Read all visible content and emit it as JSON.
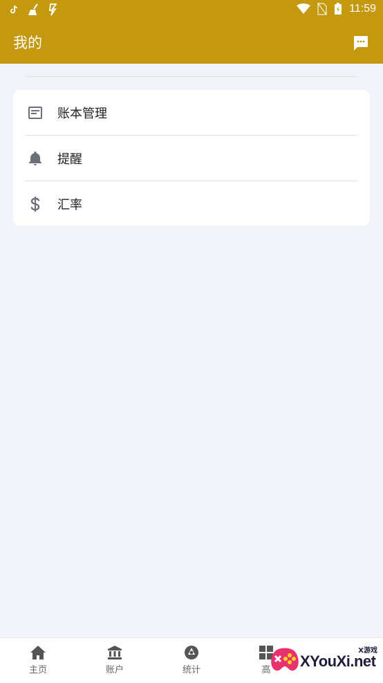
{
  "status_bar": {
    "time": "11:59",
    "left_icons": [
      "tiktok-icon",
      "broom-icon",
      "bolt-icon"
    ],
    "right_icons": [
      "wifi-icon",
      "sim-off-icon",
      "battery-icon"
    ]
  },
  "header": {
    "title": "我的",
    "action_icon": "message-icon"
  },
  "menu": {
    "items": [
      {
        "label": "账本管理",
        "icon": "ledger-icon"
      },
      {
        "label": "提醒",
        "icon": "bell-icon"
      },
      {
        "label": "汇率",
        "icon": "dollar-icon"
      }
    ]
  },
  "bottom_nav": {
    "tabs": [
      {
        "label": "主页",
        "icon": "home-icon"
      },
      {
        "label": "账户",
        "icon": "bank-icon"
      },
      {
        "label": "统计",
        "icon": "stats-icon"
      },
      {
        "label": "高",
        "icon": "grid-icon"
      }
    ]
  },
  "watermark": {
    "brand": "XYouXi.net",
    "tag": "X游戏"
  },
  "colors": {
    "primary": "#c4990f",
    "background": "#f2f3f8",
    "icon_gray": "#6b6f78"
  }
}
